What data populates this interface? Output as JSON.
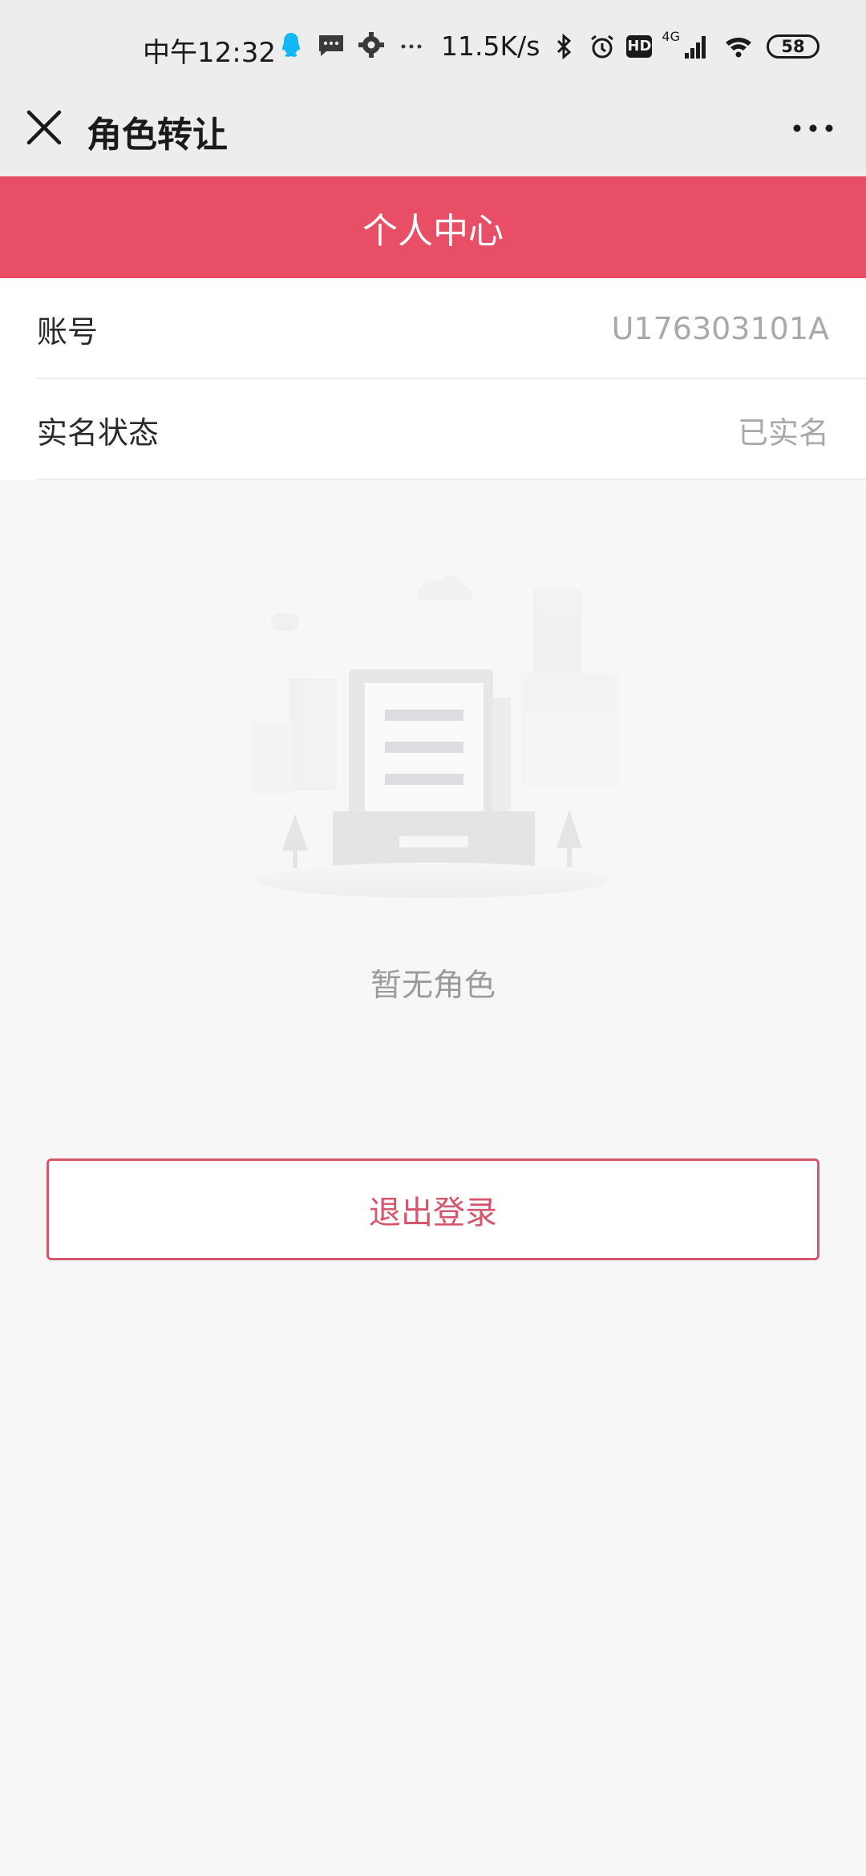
{
  "status_bar": {
    "time": "中午12:32",
    "speed": "11.5K/s",
    "hd": "HD",
    "network": "4G",
    "battery": "58"
  },
  "title_bar": {
    "title": "角色转让"
  },
  "banner": {
    "title": "个人中心"
  },
  "info": {
    "rows": [
      {
        "label": "账号",
        "value": "U176303101A"
      },
      {
        "label": "实名状态",
        "value": "已实名"
      }
    ]
  },
  "empty_state": {
    "text": "暂无角色"
  },
  "logout": {
    "label": "退出登录"
  },
  "colors": {
    "brand": "#e84f67",
    "logout": "#d6566d",
    "qq": "#12b7f5"
  }
}
